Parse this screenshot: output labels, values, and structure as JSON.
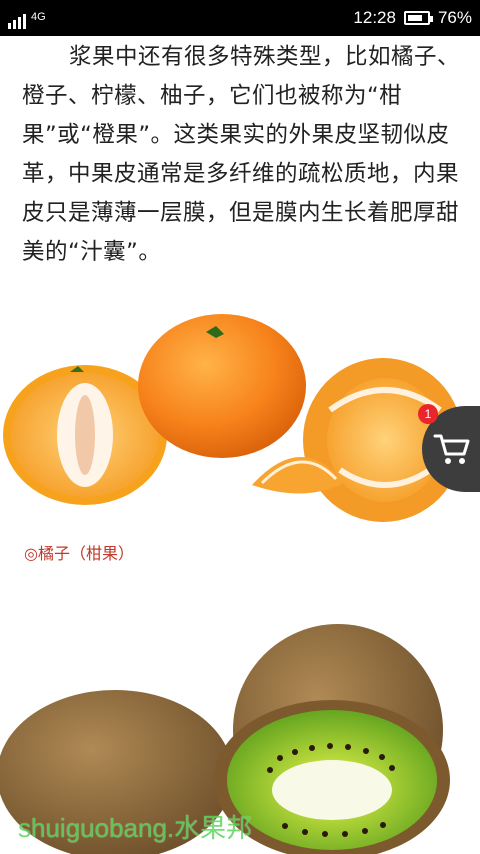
{
  "status_bar": {
    "network": "4G",
    "time": "12:28",
    "battery_percent_text": "76%",
    "battery_level": 0.76
  },
  "article": {
    "paragraph": "浆果中还有很多特殊类型，比如橘子、橙子、柠檬、柚子，它们也被称为“柑果”或“橙果”。这类果实的外果皮坚韧似皮革，中果皮通常是多纤维的疏松质地，内果皮只是薄薄一层膜，但是膜内生长着肥厚甜美的“汁囊”。"
  },
  "figure1": {
    "caption": "◎橘子（柑果）"
  },
  "cart": {
    "badge_count": "1",
    "icon": "shopping-cart-icon"
  },
  "watermark": "shuiguobang.水果邦"
}
